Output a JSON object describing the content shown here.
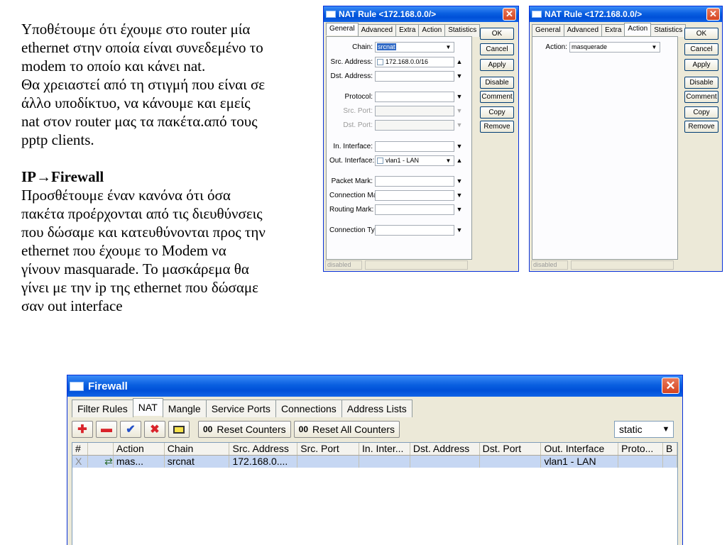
{
  "document": {
    "para1": [
      "Υποθέτουμε ότι έχουμε στο router μία",
      "ethernet στην οποία είναι συνεδεμένο το",
      "modem το οποίο και κάνει nat.",
      "Θα χρειαστεί από τη στιγμή που είναι σε",
      "άλλο υποδίκτυο, να κάνουμε και εμείς",
      "nat στον router μας τα πακέτα.από τους",
      "pptp clients."
    ],
    "heading": "IP→Firewall",
    "para2": [
      "Προσθέτουμε έναν κανόνα ότι όσα",
      "πακέτα προέρχονται από τις διευθύνσεις",
      "που δώσαμε και κατευθύνονται προς την",
      "ethernet που έχουμε το Modem να",
      "γίνουν masquarade. Το μασκάρεμα θα",
      "γίνει με την ip της ethernet που δώσαμε",
      "σαν out interface"
    ]
  },
  "nat_general": {
    "title": "NAT Rule <172.168.0.0/>",
    "tabs": [
      "General",
      "Advanced",
      "Extra",
      "Action",
      "Statistics"
    ],
    "buttons": [
      "OK",
      "Cancel",
      "Apply",
      "Disable",
      "Comment",
      "Copy",
      "Remove"
    ],
    "fields": {
      "chain_label": "Chain:",
      "chain_value": "srcnat",
      "src_label": "Src. Address:",
      "src_value": "172.168.0.0/16",
      "dst_label": "Dst. Address:",
      "protocol_label": "Protocol:",
      "src_port_label": "Src. Port:",
      "dst_port_label": "Dst. Port:",
      "in_if_label": "In. Interface:",
      "out_if_label": "Out. Interface:",
      "out_if_value": "vlan1 - LAN",
      "packet_mark_label": "Packet Mark:",
      "conn_mark_label": "Connection Mark:",
      "routing_mark_label": "Routing Mark:",
      "conn_type_label": "Connection Type:"
    },
    "status": "disabled"
  },
  "nat_action": {
    "title": "NAT Rule <172.168.0.0/>",
    "tabs": [
      "General",
      "Advanced",
      "Extra",
      "Action",
      "Statistics"
    ],
    "buttons": [
      "OK",
      "Cancel",
      "Apply",
      "Disable",
      "Comment",
      "Copy",
      "Remove"
    ],
    "action_label": "Action:",
    "action_value": "masquerade",
    "status": "disabled"
  },
  "firewall": {
    "title": "Firewall",
    "tabs": [
      "Filter Rules",
      "NAT",
      "Mangle",
      "Service Ports",
      "Connections",
      "Address Lists"
    ],
    "reset_counters": "Reset Counters",
    "reset_all_counters": "Reset All Counters",
    "filter_value": "static",
    "columns": [
      "#",
      "Action",
      "Chain",
      "Src. Address",
      "Src. Port",
      "In. Inter...",
      "Dst. Address",
      "Dst. Port",
      "Out. Interface",
      "Proto...",
      "B"
    ],
    "rows": [
      {
        "num": "X",
        "action": "mas...",
        "chain": "srcnat",
        "src": "172.168.0....",
        "src_port": "",
        "in_if": "",
        "dst": "",
        "dst_port": "",
        "out_if": "vlan1 - LAN",
        "proto": ""
      }
    ]
  }
}
